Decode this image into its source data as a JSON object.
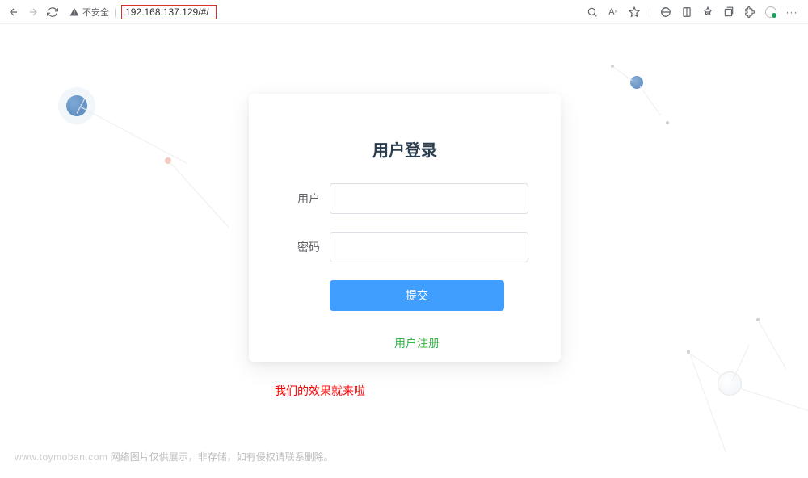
{
  "browser": {
    "insecure_label": "不安全",
    "url": "192.168.137.129/#/"
  },
  "login": {
    "title": "用户登录",
    "user_label": "用户",
    "pass_label": "密码",
    "submit_label": "提交",
    "register_label": "用户注册"
  },
  "caption": "我们的效果就来啦",
  "footer": {
    "domain": "www.toymoban.com",
    "note": "网络图片仅供展示，非存储，如有侵权请联系删除。"
  }
}
